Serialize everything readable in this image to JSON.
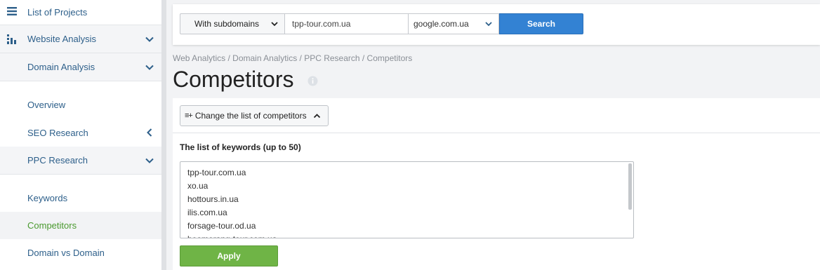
{
  "sidebar": {
    "list_of_projects": "List of Projects",
    "website_analysis": "Website Analysis",
    "domain_analysis": "Domain Analysis",
    "overview": "Overview",
    "seo_research": "SEO Research",
    "ppc_research": "PPC Research",
    "keywords": "Keywords",
    "competitors": "Competitors",
    "domain_vs_domain": "Domain vs Domain"
  },
  "search": {
    "subdomains_label": "With subdomains",
    "domain_value": "tpp-tour.com.ua",
    "engine_value": "google.com.ua",
    "button_label": "Search"
  },
  "breadcrumb": "Web Analytics / Domain Analytics / PPC Research / Competitors",
  "page_title": "Competitors",
  "change_button": {
    "icon_text": "≡+",
    "label": "Change the list of competitors"
  },
  "keywords_label": "The list of keywords (up to 50)",
  "keywords": [
    "tpp-tour.com.ua",
    "xo.ua",
    "hottours.in.ua",
    "ilis.com.ua",
    "forsage-tour.od.ua",
    "boomerang-tour.com.ua"
  ],
  "apply_label": "Apply",
  "colors": {
    "accent_blue": "#3382d3",
    "apply_green": "#6fb446",
    "active_green": "#4a9a2f",
    "link_blue": "#2d5f8a"
  }
}
